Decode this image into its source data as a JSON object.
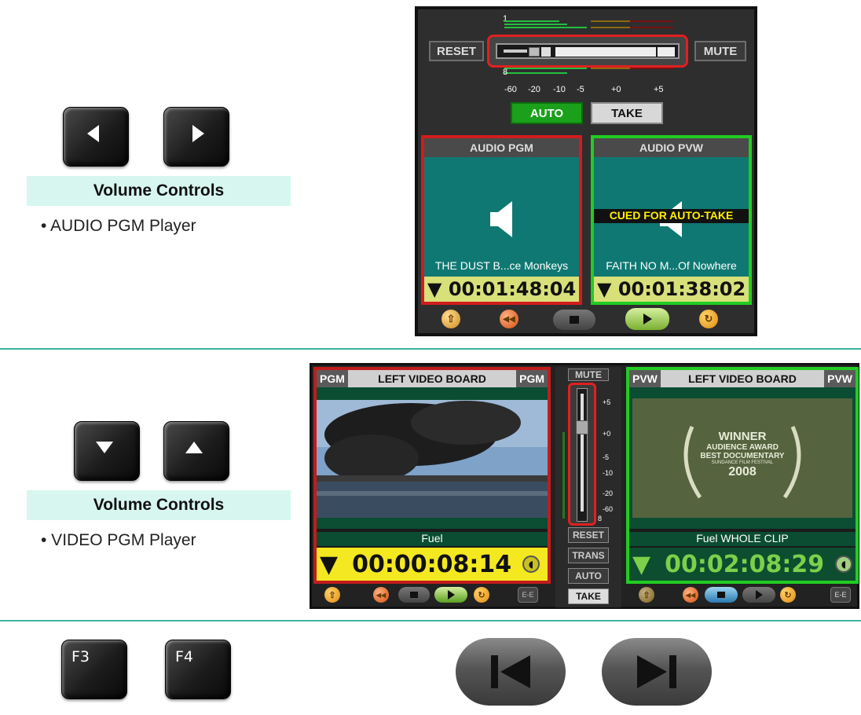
{
  "sections": [
    {
      "keys": [
        "left-arrow",
        "right-arrow"
      ],
      "title": "Volume Controls",
      "bullet": "• AUDIO PGM Player"
    },
    {
      "keys": [
        "down-arrow",
        "up-arrow"
      ],
      "title": "Volume Controls",
      "bullet": "• VIDEO PGM Player"
    },
    {
      "keys": [
        "F3",
        "F4"
      ]
    }
  ],
  "audio_panel": {
    "reset_label": "RESET",
    "mute_label": "MUTE",
    "meter_top_label": "1",
    "meter_bottom_label": "8",
    "scale": [
      "-60",
      "-20",
      "-10",
      "-5",
      "+0",
      "+5"
    ],
    "auto_label": "AUTO",
    "take_label": "TAKE",
    "pgm": {
      "header": "AUDIO PGM",
      "clip": "THE DUST B...ce Monkeys",
      "timecode": "▼ 00:01:48:04",
      "border": "#d01c1c"
    },
    "pvw": {
      "header": "AUDIO PVW",
      "cued": "CUED FOR AUTO-TAKE",
      "clip": "FAITH NO M...Of Nowhere",
      "timecode": "▼ 00:01:38:02",
      "border": "#22cc22"
    }
  },
  "video_panel": {
    "pgm": {
      "tag_left": "PGM",
      "title": "LEFT VIDEO BOARD",
      "tag_right": "PGM",
      "clip": "Fuel",
      "timecode": "00:00:08:14",
      "arrow": "▼"
    },
    "pvw": {
      "tag_left": "PVW",
      "title": "LEFT VIDEO BOARD",
      "tag_right": "PVW",
      "clip": "Fuel WHOLE CLIP",
      "timecode": "00:02:08:29",
      "arrow": "▼",
      "poster": {
        "line1": "WINNER",
        "line2": "AUDIENCE AWARD",
        "line3": "BEST DOCUMENTARY",
        "line4": "SUNDANCE FILM FESTIVAL",
        "line5": "2008"
      }
    },
    "mixer": {
      "mute": "MUTE",
      "reset": "RESET",
      "trans": "TRANS",
      "auto": "AUTO",
      "take": "TAKE",
      "ticks": [
        "+5",
        "+0",
        "-5",
        "-10",
        "-20",
        "-60"
      ],
      "bottom_tick": "8"
    },
    "ee_label": "E-E"
  }
}
